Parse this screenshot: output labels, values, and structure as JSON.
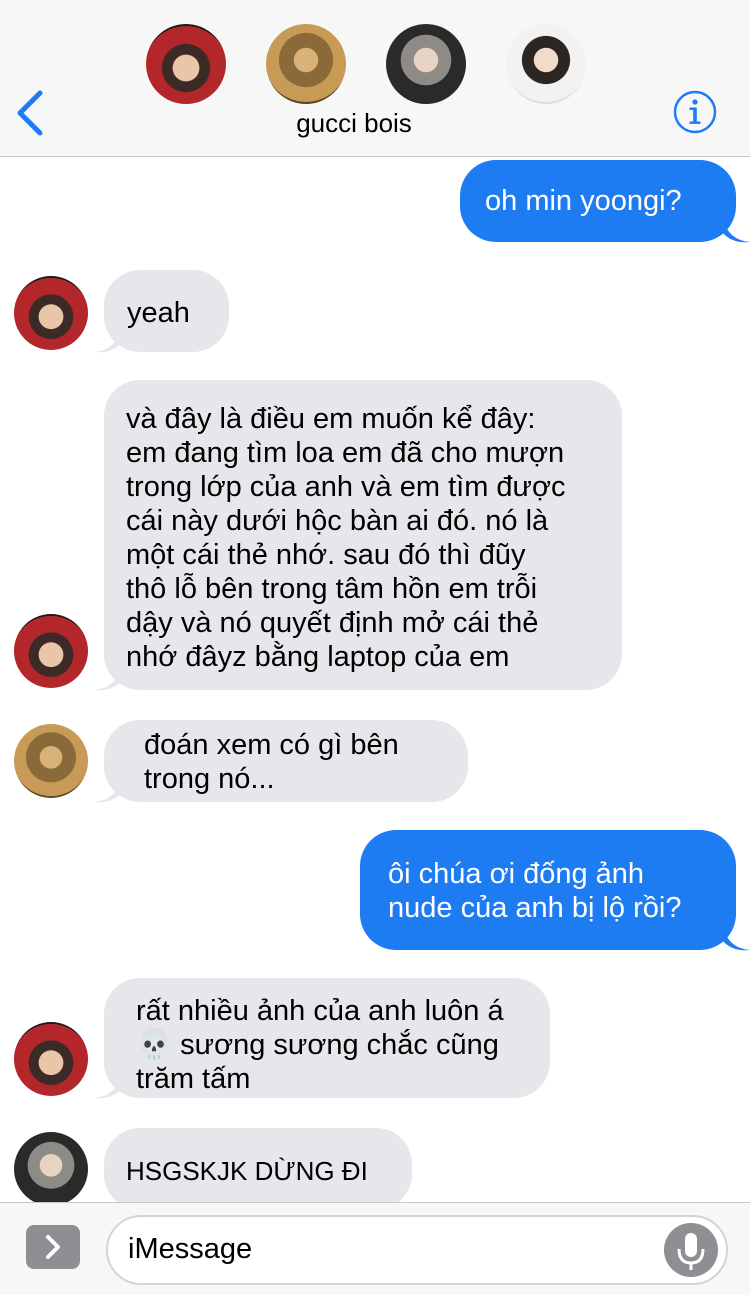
{
  "header": {
    "group_name": "gucci bois",
    "member_avatars": [
      "avatar-1",
      "avatar-2",
      "avatar-3",
      "avatar-4"
    ],
    "back_icon": "chevron-left-icon",
    "info_icon": "info-icon"
  },
  "messages": [
    {
      "side": "out",
      "text": "oh min yoongi?"
    },
    {
      "side": "in",
      "sender_avatar": "avatar-1",
      "text": "yeah"
    },
    {
      "side": "in",
      "sender_avatar": "avatar-1",
      "text": "và đây là điều em muốn kể đây:\nem đang tìm loa em đã cho mượn\ntrong lớp của anh và em tìm được\ncái này dưới hộc bàn ai đó. nó là\nmột cái thẻ nhớ. sau đó thì đũy\nthô lỗ bên trong tâm hồn em trỗi\ndậy và nó quyết định mở cái thẻ\nnhớ đâyz bằng laptop của em"
    },
    {
      "side": "in",
      "sender_avatar": "avatar-2",
      "text": "đoán xem có gì bên\ntrong nó..."
    },
    {
      "side": "out",
      "text": "ôi chúa ơi đống ảnh\nnude của anh bị lộ rồi?"
    },
    {
      "side": "in",
      "sender_avatar": "avatar-1",
      "text": "rất nhiều ảnh của anh luôn á\n💀 sương sương chắc cũng\ntrăm tấm"
    },
    {
      "side": "in",
      "sender_avatar": "avatar-3",
      "text": "HSGSKJK DỪNG ĐI"
    }
  ],
  "input": {
    "placeholder": "iMessage",
    "apps_icon": "chevron-right-icon",
    "mic_icon": "microphone-icon"
  },
  "colors": {
    "outgoing_bubble": "#1e7cf2",
    "incoming_bubble": "#e6e6eb",
    "accent": "#1e7cf2"
  }
}
